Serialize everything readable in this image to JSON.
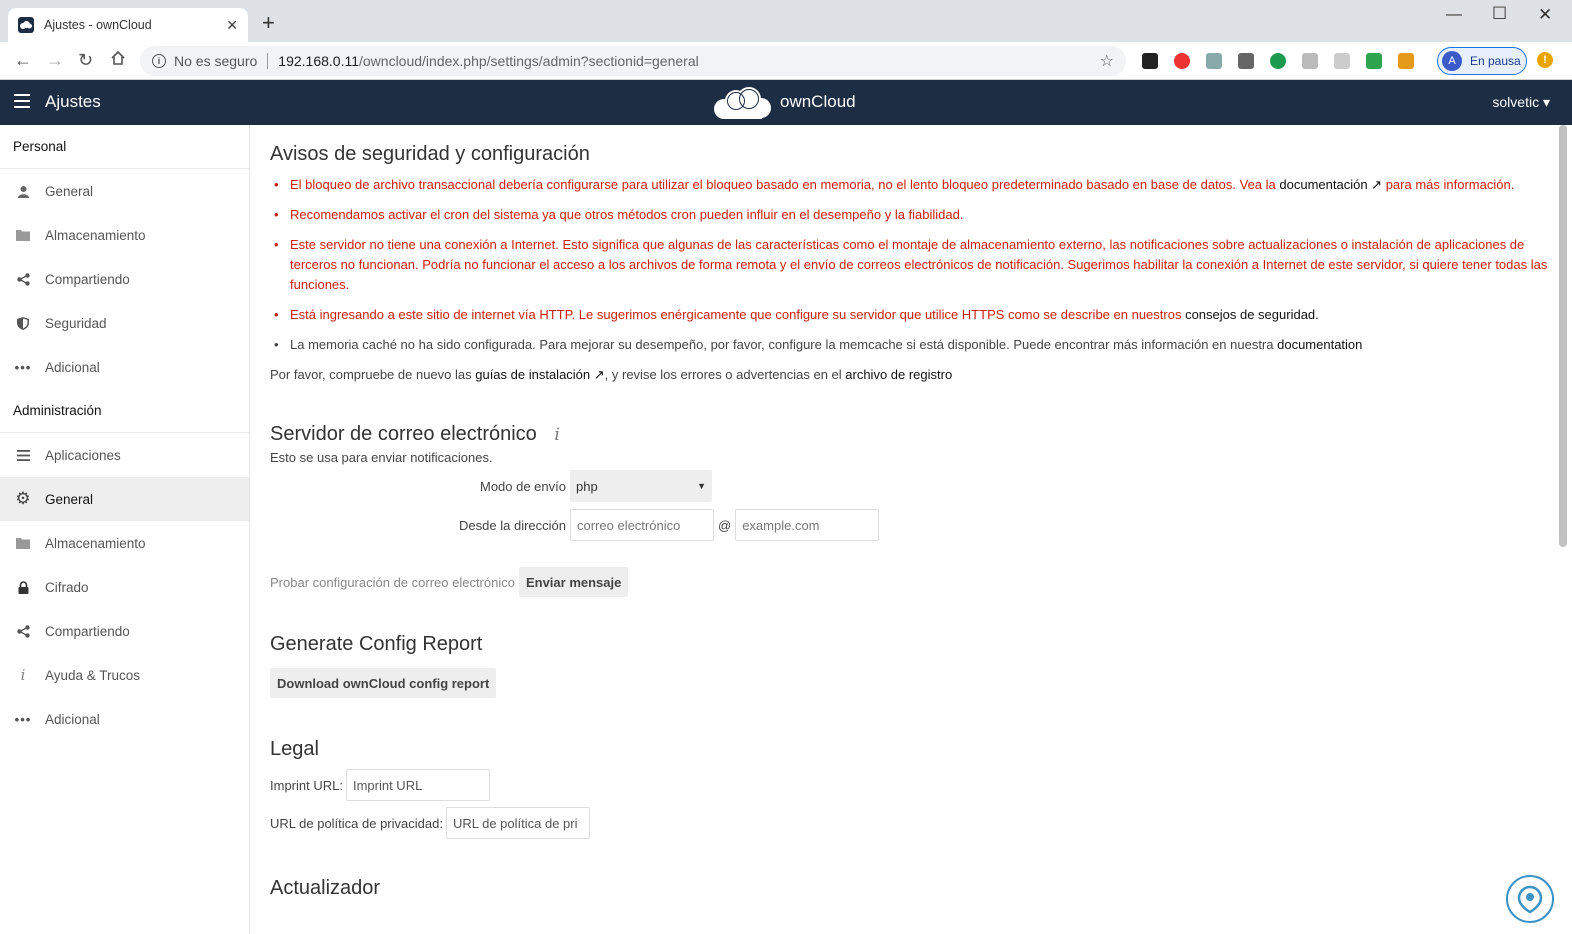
{
  "browser": {
    "tab_title": "Ajustes - ownCloud",
    "tab_close": "✕",
    "new_tab": "+",
    "security_label": "No es seguro",
    "url_host": "192.168.0.11",
    "url_path": "/owncloud/index.php/settings/admin?sectionid=general",
    "profile_initial": "A",
    "profile_status": "En pausa",
    "alert_icon": "!"
  },
  "header": {
    "app_title": "Ajustes",
    "brand": "ownCloud",
    "user": "solvetic ▾"
  },
  "sidebar": {
    "personal_title": "Personal",
    "personal_items": [
      {
        "label": "General",
        "icon": "person-icon"
      },
      {
        "label": "Almacenamiento",
        "icon": "folder-icon"
      },
      {
        "label": "Compartiendo",
        "icon": "share-icon"
      },
      {
        "label": "Seguridad",
        "icon": "shield-icon"
      },
      {
        "label": "Adicional",
        "icon": "more-icon"
      }
    ],
    "admin_title": "Administración",
    "admin_items": [
      {
        "label": "Aplicaciones",
        "icon": "list-icon"
      },
      {
        "label": "General",
        "icon": "gear-icon",
        "active": true
      },
      {
        "label": "Almacenamiento",
        "icon": "folder-icon"
      },
      {
        "label": "Cifrado",
        "icon": "lock-icon"
      },
      {
        "label": "Compartiendo",
        "icon": "share-icon"
      },
      {
        "label": "Ayuda & Trucos",
        "icon": "info-icon"
      },
      {
        "label": "Adicional",
        "icon": "more-icon"
      }
    ]
  },
  "security": {
    "title": "Avisos de seguridad y configuración",
    "w1_text": "El bloqueo de archivo transaccional debería configurarse para utilizar el bloqueo basado en memoria, no el lento bloqueo predeterminado basado en base de datos. Vea la ",
    "w1_link": "documentación ↗",
    "w1_tail": " para más información.",
    "w2_text": "Recomendamos activar el cron del sistema ya que otros métodos cron pueden influir en el desempeño y la fiabilidad.",
    "w3_text": "Este servidor no tiene una conexión a Internet. Esto significa que algunas de las características como el montaje de almacenamiento externo, las notificaciones sobre actualizaciones o instalación de aplicaciones de terceros no funcionan. Podría no funcionar el acceso a los archivos de forma remota y el envío de correos electrónicos de notificación. Sugerimos habilitar la conexión a Internet de este servidor, si quiere tener todas las funciones.",
    "w4_text": "Está ingresando a este sitio de internet vía HTTP. Le sugerimos enérgicamente que configure su servidor que utilice HTTPS como se describe en nuestros ",
    "w4_link": "consejos de seguridad",
    "w4_tail": ".",
    "w5_text": "La memoria caché no ha sido configurada. Para mejorar su desempeño, por favor, configure la memcache si está disponible. Puede encontrar más información en nuestra ",
    "w5_link": "documentation",
    "recheck_1": "Por favor, compruebe de nuevo las ",
    "recheck_link1": "guías de instalación ↗",
    "recheck_2": ", y revise los errores o advertencias en el ",
    "recheck_link2": "archivo de registro"
  },
  "mail": {
    "title": "Servidor de correo electrónico",
    "info_icon": "i",
    "description": "Esto se usa para enviar notificaciones.",
    "mode_label": "Modo de envío",
    "mode_value": "php",
    "from_label": "Desde la dirección",
    "from_placeholder": "correo electrónico",
    "at": "@",
    "domain_placeholder": "example.com",
    "test_label": "Probar configuración de correo electrónico",
    "send_button": "Enviar mensaje"
  },
  "config_report": {
    "title": "Generate Config Report",
    "button": "Download ownCloud config report"
  },
  "legal": {
    "title": "Legal",
    "imprint_label": "Imprint URL:",
    "imprint_placeholder": "Imprint URL",
    "privacy_label": "URL de política de privacidad:",
    "privacy_placeholder": "URL de política de pri"
  },
  "updater": {
    "title": "Actualizador"
  },
  "colors": {
    "header_bg": "#1d2d44",
    "warning_red": "#c9210d"
  }
}
